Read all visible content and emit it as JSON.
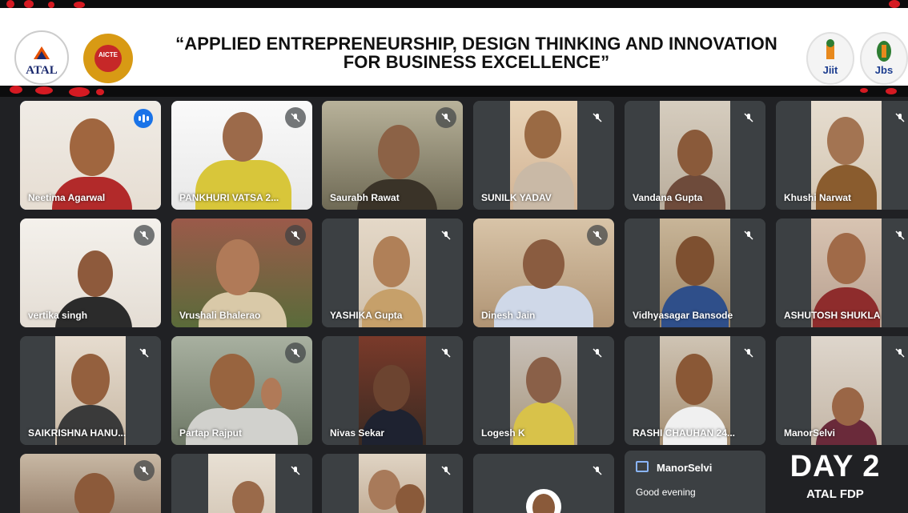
{
  "banner": {
    "title_line1": "“APPLIED ENTREPRENEURSHIP, DESIGN THINKING AND INNOVATION",
    "title_line2": "FOR BUSINESS EXCELLENCE”",
    "logos": {
      "atal": "ATAL",
      "aicte": "AICTE",
      "jiit": "Jiit",
      "jbs": "Jbs"
    },
    "accent_color": "#d51a22"
  },
  "participants": [
    {
      "name": "Neetima Agarwal",
      "muted": false,
      "speaking": true
    },
    {
      "name": "PANKHURI VATSA 2...",
      "muted": true
    },
    {
      "name": "Saurabh Rawat",
      "muted": true
    },
    {
      "name": "SUNILK YADAV",
      "muted": true
    },
    {
      "name": "Vandana Gupta",
      "muted": true
    },
    {
      "name": "Khushi Narwat",
      "muted": true
    },
    {
      "name": "vertika singh",
      "muted": true
    },
    {
      "name": "Vrushali Bhalerao",
      "muted": true
    },
    {
      "name": "YASHIKA Gupta",
      "muted": true
    },
    {
      "name": "Dinesh Jain",
      "muted": true
    },
    {
      "name": "Vidhyasagar Bansode",
      "muted": true
    },
    {
      "name": "ASHUTOSH SHUKLA",
      "muted": true
    },
    {
      "name": "SAIKRISHNA HANU...",
      "muted": true
    },
    {
      "name": "Partap Rajput",
      "muted": true
    },
    {
      "name": "Nivas Sekar",
      "muted": true
    },
    {
      "name": "Logesh K",
      "muted": true
    },
    {
      "name": "RASHI CHAUHAN 24...",
      "muted": true
    },
    {
      "name": "ManorSelvi",
      "muted": true
    }
  ],
  "chat": {
    "sender": "ManorSelvi",
    "message": "Good evening"
  },
  "overlay": {
    "day": "DAY 2",
    "event": "ATAL FDP"
  }
}
